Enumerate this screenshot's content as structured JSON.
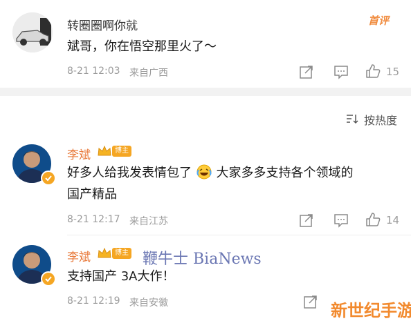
{
  "reply": {
    "username": "转圈圈啊你就",
    "text": "斌哥，你在悟空那里火了～",
    "date": "8-21 12:03",
    "location": "来自广西",
    "likes": "15",
    "first_badge": "首评"
  },
  "sort": {
    "label": "按热度"
  },
  "comments": [
    {
      "username": "李斌",
      "badge": "博主",
      "text_line1": "好多人给我发表情包了",
      "text_line1b": "大家多多支持各个领域的",
      "text_line2": "国产精品",
      "date": "8-21 12:17",
      "location": "来自江苏",
      "likes": "14"
    },
    {
      "username": "李斌",
      "badge": "博主",
      "text": "支持国产 3A大作！",
      "date": "8-21 12:19",
      "location": "来自安徽"
    }
  ],
  "watermarks": {
    "bianews": "鞭牛士 BiaNews",
    "site": "新世纪手游"
  },
  "colors": {
    "accent": "#e8793a",
    "meta": "#9b9b9b",
    "badge": "#f5a623",
    "verified": "#f5a623"
  }
}
